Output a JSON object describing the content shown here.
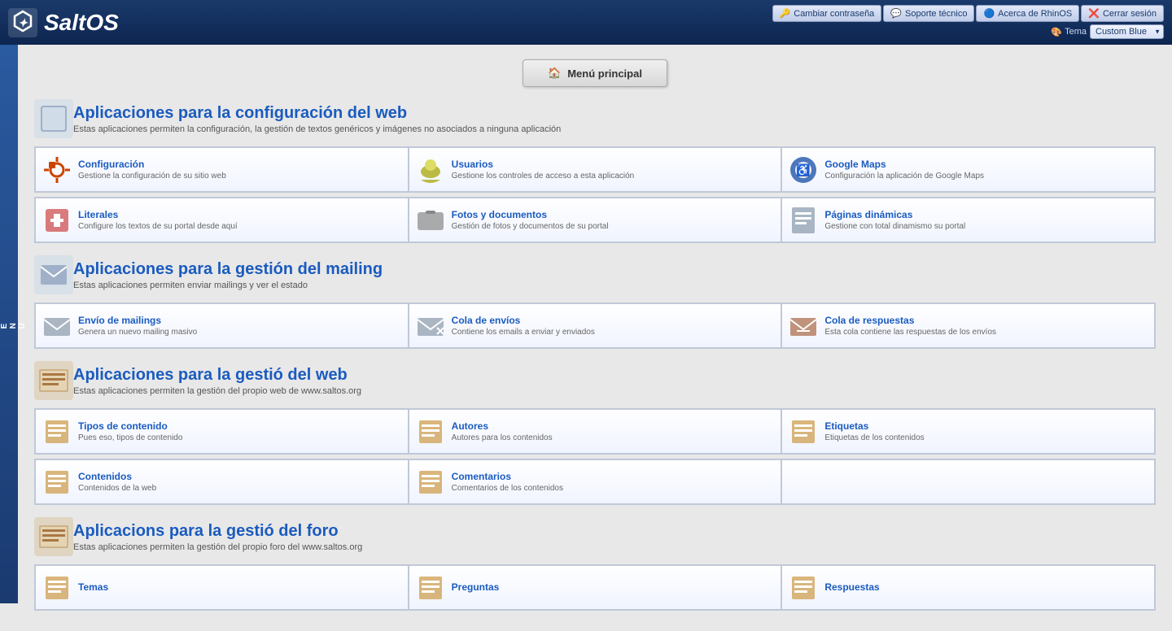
{
  "header": {
    "logo_text": "SaltOS",
    "buttons": [
      {
        "label": "Cambiar contraseña",
        "icon": "🔑",
        "name": "change-password-button"
      },
      {
        "label": "Soporte técnico",
        "icon": "💬",
        "name": "support-button"
      },
      {
        "label": "Acerca de RhinOS",
        "icon": "🔵",
        "name": "about-button"
      },
      {
        "label": "Cerrar sesión",
        "icon": "❌",
        "name": "logout-button"
      }
    ],
    "theme_label": "Tema",
    "theme_value": "Custom Blue",
    "theme_icon": "🎨"
  },
  "sidebar": {
    "label": "M\nE\nN\nU"
  },
  "main_menu": {
    "button_label": "Menú principal",
    "icon": "🏠"
  },
  "sections": [
    {
      "id": "config-web",
      "title": "Aplicaciones para la configuración del web",
      "desc": "Estas aplicaciones permiten la configuración, la gestión de textos genéricos y imágenes no asociados a ninguna aplicación",
      "icon": "🔧",
      "apps": [
        [
          {
            "name": "Configuración",
            "desc": "Gestione la configuración de su sitio web",
            "icon": "🔧"
          },
          {
            "name": "Usuarios",
            "desc": "Gestione los controles de acceso a esta aplicación",
            "icon": "🗝️"
          },
          {
            "name": "Google Maps",
            "desc": "Configuración la aplicación de Google Maps",
            "icon": "♿"
          }
        ],
        [
          {
            "name": "Literales",
            "desc": "Configure los textos de su portal desde aquí",
            "icon": "🔌"
          },
          {
            "name": "Fotos y documentos",
            "desc": "Gestión de fotos y documentos de su portal",
            "icon": "📷"
          },
          {
            "name": "Páginas dinámicas",
            "desc": "Gestione con total dinamismo su portal",
            "icon": "📋"
          }
        ]
      ]
    },
    {
      "id": "mailing",
      "title": "Aplicaciones para la gestión del mailing",
      "desc": "Estas aplicaciones permiten enviar mailings y ver el estado",
      "icon": "📧",
      "apps": [
        [
          {
            "name": "Envío de mailings",
            "desc": "Genera un nuevo mailing masivo",
            "icon": "✉️"
          },
          {
            "name": "Cola de envíos",
            "desc": "Contiene los emails a enviar y enviados",
            "icon": "📨"
          },
          {
            "name": "Cola de respuestas",
            "desc": "Esta cola contiene las respuestas de los envíos",
            "icon": "📩"
          }
        ]
      ]
    },
    {
      "id": "web-mgmt",
      "title": "Aplicaciones para la gestió del web",
      "desc": "Estas aplicaciones permiten la gestión del propio web de www.saltos.org",
      "icon": "📄",
      "apps": [
        [
          {
            "name": "Tipos de contenido",
            "desc": "Pues eso, tipos de contenido",
            "icon": "📄"
          },
          {
            "name": "Autores",
            "desc": "Autores para los contenidos",
            "icon": "📄"
          },
          {
            "name": "Etiquetas",
            "desc": "Etiquetas de los contenidos",
            "icon": "📄"
          }
        ],
        [
          {
            "name": "Contenidos",
            "desc": "Contenidos de la web",
            "icon": "📄"
          },
          {
            "name": "Comentarios",
            "desc": "Comentarios de los contenidos",
            "icon": "📄"
          },
          {
            "name": "",
            "desc": "",
            "icon": ""
          }
        ]
      ]
    },
    {
      "id": "forum",
      "title": "Aplicacions para la gestió del foro",
      "desc": "Estas aplicaciones permiten la gestión del propio foro del www.saltos.org",
      "icon": "💬",
      "apps": [
        [
          {
            "name": "Temas",
            "desc": "",
            "icon": "📄"
          },
          {
            "name": "Preguntas",
            "desc": "",
            "icon": "📄"
          },
          {
            "name": "Respuestas",
            "desc": "",
            "icon": "📄"
          }
        ]
      ]
    }
  ]
}
